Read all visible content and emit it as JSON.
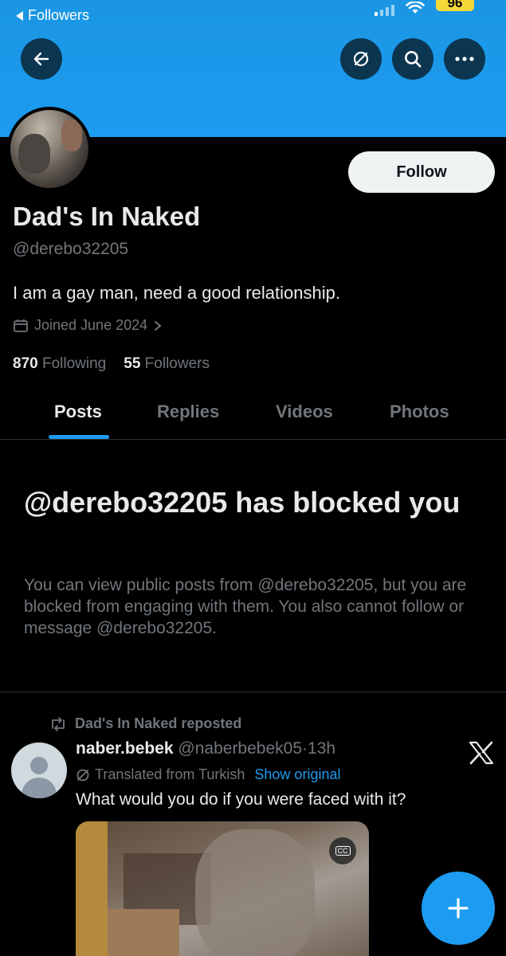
{
  "status_bar": {
    "back_label": "Followers",
    "battery": "96"
  },
  "nav": {
    "back_icon": "arrow-left-icon",
    "grok_icon": "grok-icon",
    "search_icon": "search-icon",
    "more_icon": "more-icon"
  },
  "profile": {
    "name": "Dad's In Naked",
    "handle": "@derebo32205",
    "bio": "I am a gay man, need a good relationship.",
    "joined": "Joined June 2024",
    "following_count": "870",
    "following_label": "Following",
    "followers_count": "55",
    "followers_label": "Followers",
    "follow_button": "Follow"
  },
  "tabs": [
    "Posts",
    "Replies",
    "Videos",
    "Photos"
  ],
  "active_tab": "Posts",
  "blocked": {
    "title": "@derebo32205 has blocked you",
    "body": "You can view public posts from @derebo32205, but you are blocked from engaging with them. You also cannot follow or message @derebo32205."
  },
  "post": {
    "repost_label": "Dad's In Naked reposted",
    "author": "naber.bebek",
    "author_handle": "@naberbebek05",
    "separator": "·",
    "time": "13h",
    "translated_label": "Translated from Turkish",
    "show_original": "Show original",
    "text": "What would you do if you were faced with it?",
    "cc_label": "CC"
  },
  "colors": {
    "accent": "#1d9bf0",
    "banner": "#1d9bf0",
    "background": "#000000",
    "muted": "#71767b",
    "battery": "#f4d83a"
  }
}
